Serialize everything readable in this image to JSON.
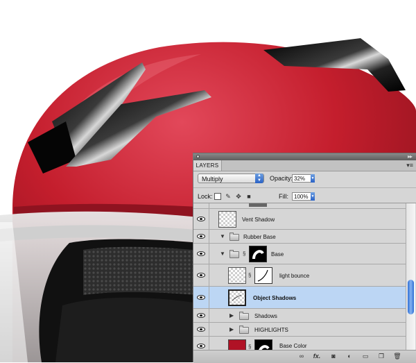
{
  "colors": {
    "helmet_red": "#c41e2d",
    "selection": "#bcd6f4",
    "accent_blue": "#2a62c6"
  },
  "panel": {
    "tab_label": "LAYERS",
    "blend_mode": "Multiply",
    "opacity_label": "Opacity:",
    "opacity_value": "32%",
    "lock_label": "Lock:",
    "fill_label": "Fill:",
    "fill_value": "100%",
    "lock_icons": [
      "lock-transparency-icon",
      "lock-brush-icon",
      "lock-move-icon",
      "lock-all-icon"
    ],
    "bottom_icons": [
      "link-layers-icon",
      "fx-icon",
      "add-mask-icon",
      "adjustment-layer-icon",
      "new-group-icon",
      "new-layer-icon",
      "trash-icon"
    ],
    "fx_symbol": "fx."
  },
  "layers": [
    {
      "name": "Vent Shadow",
      "kind": "layer"
    },
    {
      "name": "Rubber Base",
      "kind": "group-open"
    },
    {
      "name": "Base",
      "kind": "group-open-masked"
    },
    {
      "name": "light bounce",
      "kind": "layer-masked"
    },
    {
      "name": "Object Shadows",
      "kind": "layer",
      "selected": true
    },
    {
      "name": "Shadows",
      "kind": "group-closed"
    },
    {
      "name": "HIGHLIGHTS",
      "kind": "group-closed"
    },
    {
      "name": "Base Color",
      "kind": "layer-masked"
    }
  ]
}
